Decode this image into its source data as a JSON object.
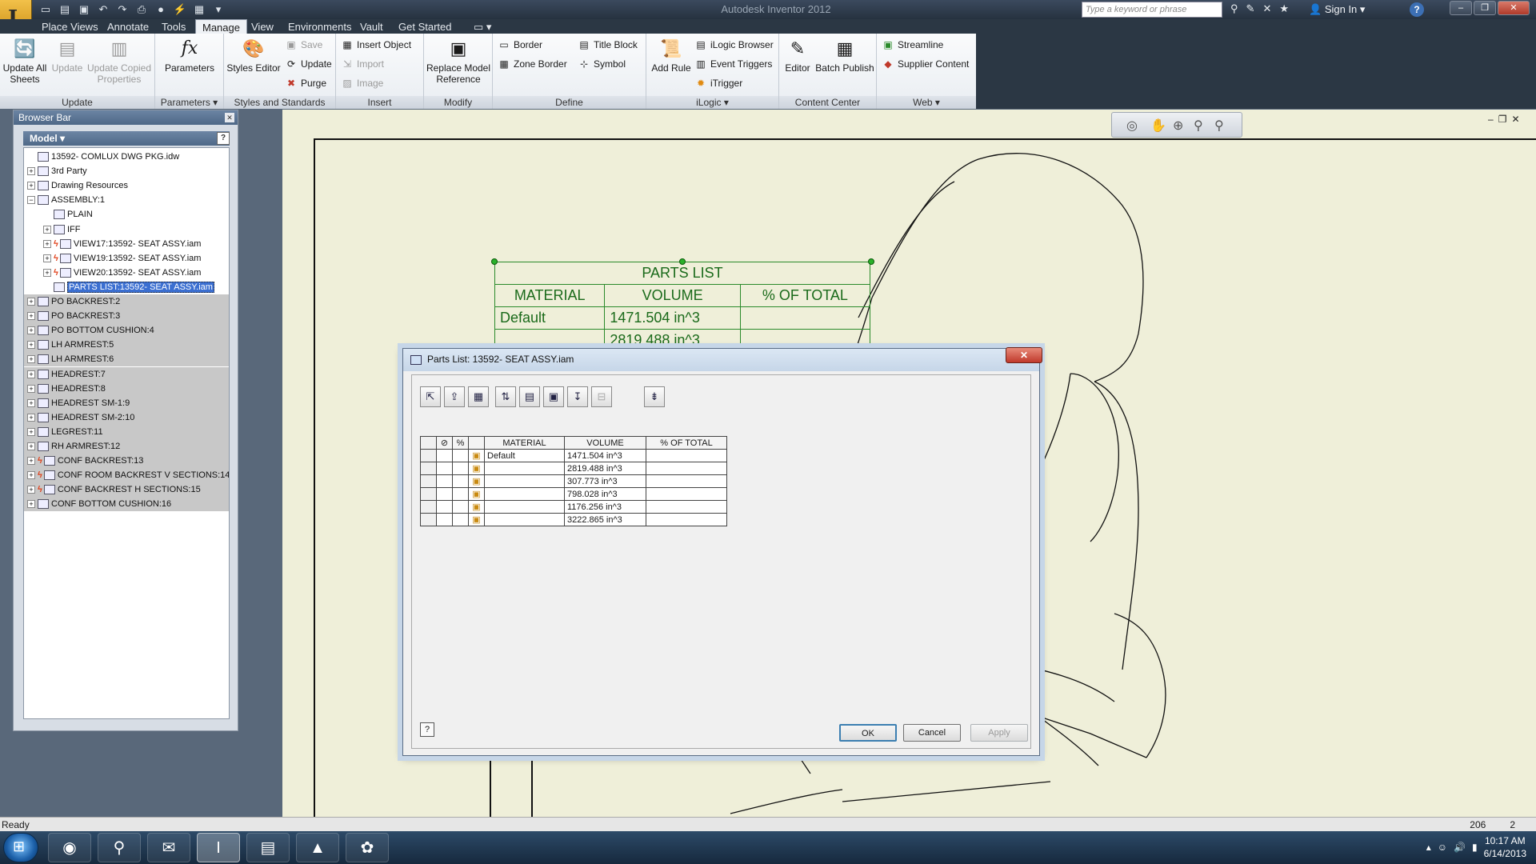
{
  "app": {
    "title": "Autodesk Inventor 2012",
    "search_placeholder": "Type a keyword or phrase",
    "sign_in": "Sign In"
  },
  "tabs": [
    {
      "label": "Place Views",
      "active": false
    },
    {
      "label": "Annotate",
      "active": false
    },
    {
      "label": "Tools",
      "active": false
    },
    {
      "label": "Manage",
      "active": true
    },
    {
      "label": "View",
      "active": false
    },
    {
      "label": "Environments",
      "active": false
    },
    {
      "label": "Vault",
      "active": false
    },
    {
      "label": "Get Started",
      "active": false
    }
  ],
  "ribbon": {
    "update_panel": {
      "title": "Update",
      "update_all": "Update All Sheets",
      "update": "Update",
      "update_copied": "Update Copied Properties"
    },
    "parameters_panel": {
      "title": "Parameters",
      "parameters": "Parameters"
    },
    "styles_panel": {
      "title": "Styles and Standards",
      "styles_editor": "Styles Editor",
      "save": "Save",
      "update": "Update",
      "purge": "Purge"
    },
    "insert_panel": {
      "title": "Insert",
      "insert_object": "Insert Object",
      "import": "Import",
      "image": "Image"
    },
    "modify_panel": {
      "title": "Modify",
      "replace_model": "Replace Model Reference"
    },
    "define_panel": {
      "title": "Define",
      "border": "Border",
      "zone_border": "Zone Border",
      "title_block": "Title Block",
      "symbol": "Symbol"
    },
    "ilogic_panel": {
      "title": "iLogic",
      "add_rule": "Add Rule",
      "browser": "iLogic Browser",
      "event_triggers": "Event Triggers",
      "itrigger": "iTrigger"
    },
    "content_center_panel": {
      "title": "Content Center",
      "editor": "Editor",
      "batch_publish": "Batch Publish"
    },
    "web_panel": {
      "title": "Web",
      "streamline": "Streamline",
      "supplier_content": "Supplier Content"
    }
  },
  "browser": {
    "title": "Browser Bar",
    "mode": "Model",
    "items": [
      {
        "label": "13592- COMLUX DWG PKG.idw",
        "level": 0,
        "expander": "",
        "bolt": false,
        "style": ""
      },
      {
        "label": "3rd Party",
        "level": 0,
        "expander": "+",
        "bolt": false,
        "style": ""
      },
      {
        "label": "Drawing Resources",
        "level": 0,
        "expander": "+",
        "bolt": false,
        "style": ""
      },
      {
        "label": "ASSEMBLY:1",
        "level": 0,
        "expander": "−",
        "bolt": false,
        "style": ""
      },
      {
        "label": "PLAIN",
        "level": 1,
        "expander": "",
        "bolt": false,
        "style": ""
      },
      {
        "label": "IFF",
        "level": 1,
        "expander": "+",
        "bolt": false,
        "style": ""
      },
      {
        "label": "VIEW17:13592- SEAT ASSY.iam",
        "level": 1,
        "expander": "+",
        "bolt": true,
        "style": ""
      },
      {
        "label": "VIEW19:13592- SEAT ASSY.iam",
        "level": 1,
        "expander": "+",
        "bolt": true,
        "style": ""
      },
      {
        "label": "VIEW20:13592- SEAT ASSY.iam",
        "level": 1,
        "expander": "+",
        "bolt": true,
        "style": ""
      },
      {
        "label": "PARTS LIST:13592- SEAT ASSY.iam",
        "level": 1,
        "expander": "",
        "bolt": false,
        "style": "sel"
      },
      {
        "label": "PO  BACKREST:2",
        "level": 0,
        "expander": "+",
        "bolt": false,
        "style": "grey"
      },
      {
        "label": "PO  BACKREST:3",
        "level": 0,
        "expander": "+",
        "bolt": false,
        "style": "grey"
      },
      {
        "label": "PO BOTTOM CUSHION:4",
        "level": 0,
        "expander": "+",
        "bolt": false,
        "style": "grey"
      },
      {
        "label": "LH ARMREST:5",
        "level": 0,
        "expander": "+",
        "bolt": false,
        "style": "grey"
      },
      {
        "label": "LH ARMREST:6",
        "level": 0,
        "expander": "+",
        "bolt": false,
        "style": "grey"
      },
      {
        "label": "HEADREST:7",
        "level": 0,
        "expander": "+",
        "bolt": false,
        "style": "grey"
      },
      {
        "label": "HEADREST:8",
        "level": 0,
        "expander": "+",
        "bolt": false,
        "style": "grey"
      },
      {
        "label": "HEADREST SM-1:9",
        "level": 0,
        "expander": "+",
        "bolt": false,
        "style": "grey"
      },
      {
        "label": "HEADREST SM-2:10",
        "level": 0,
        "expander": "+",
        "bolt": false,
        "style": "grey"
      },
      {
        "label": "LEGREST:11",
        "level": 0,
        "expander": "+",
        "bolt": false,
        "style": "grey"
      },
      {
        "label": "RH ARMREST:12",
        "level": 0,
        "expander": "+",
        "bolt": false,
        "style": "grey"
      },
      {
        "label": "CONF BACKREST:13",
        "level": 0,
        "expander": "+",
        "bolt": true,
        "style": "grey"
      },
      {
        "label": "CONF ROOM BACKREST V SECTIONS:14",
        "level": 0,
        "expander": "+",
        "bolt": true,
        "style": "grey"
      },
      {
        "label": "CONF BACKREST H SECTIONS:15",
        "level": 0,
        "expander": "+",
        "bolt": true,
        "style": "grey"
      },
      {
        "label": "CONF BOTTOM CUSHION:16",
        "level": 0,
        "expander": "+",
        "bolt": false,
        "style": "grey"
      }
    ]
  },
  "drawing_parts_list": {
    "title": "PARTS LIST",
    "headers": [
      "MATERIAL",
      "VOLUME",
      "% OF TOTAL"
    ],
    "rows": [
      [
        "Default",
        "1471.504 in^3",
        ""
      ],
      [
        "",
        "2819.488 in^3",
        ""
      ]
    ]
  },
  "dialog": {
    "title": "Parts List: 13592- SEAT ASSY.iam",
    "columns": [
      "MATERIAL",
      "VOLUME",
      "% OF TOTAL"
    ],
    "rows": [
      {
        "material": "Default",
        "volume": "1471.504 in^3",
        "pct": ""
      },
      {
        "material": "",
        "volume": "2819.488 in^3",
        "pct": ""
      },
      {
        "material": "",
        "volume": "307.773 in^3",
        "pct": ""
      },
      {
        "material": "",
        "volume": "798.028 in^3",
        "pct": ""
      },
      {
        "material": "",
        "volume": "1176.256 in^3",
        "pct": ""
      },
      {
        "material": "",
        "volume": "3222.865 in^3",
        "pct": ""
      }
    ],
    "ok": "OK",
    "cancel": "Cancel",
    "apply": "Apply"
  },
  "status": {
    "text": "Ready",
    "num1": "206",
    "num2": "2"
  },
  "taskbar": {
    "time": "10:17 AM",
    "date": "6/14/2013"
  }
}
